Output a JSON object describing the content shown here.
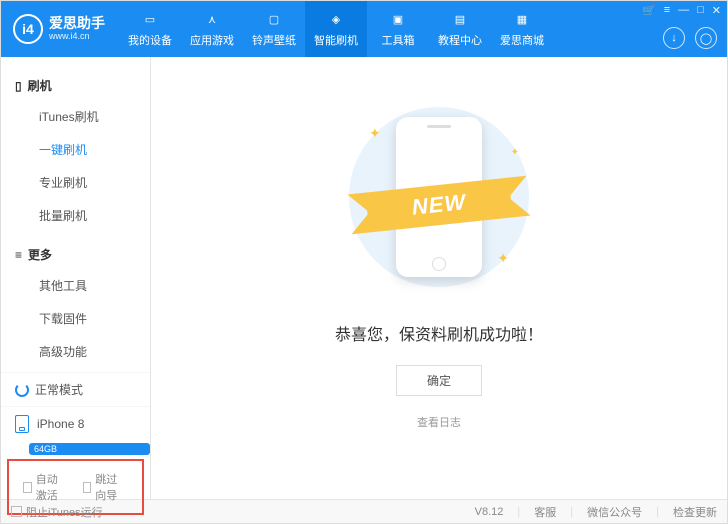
{
  "logo": {
    "badge": "i4",
    "title": "爱思助手",
    "subtitle": "www.i4.cn"
  },
  "nav": [
    {
      "label": "我的设备",
      "icon": "phone"
    },
    {
      "label": "应用游戏",
      "icon": "apps"
    },
    {
      "label": "铃声壁纸",
      "icon": "music"
    },
    {
      "label": "智能刷机",
      "icon": "flash",
      "active": true
    },
    {
      "label": "工具箱",
      "icon": "toolbox"
    },
    {
      "label": "教程中心",
      "icon": "book"
    },
    {
      "label": "爱思商城",
      "icon": "shop"
    }
  ],
  "sidebar": {
    "flash": {
      "title": "刷机",
      "items": [
        "iTunes刷机",
        "一键刷机",
        "专业刷机",
        "批量刷机"
      ],
      "activeIndex": 1
    },
    "more": {
      "title": "更多",
      "items": [
        "其他工具",
        "下载固件",
        "高级功能"
      ]
    },
    "status": "正常模式",
    "device": {
      "name": "iPhone 8",
      "storage": "64GB"
    },
    "checks": {
      "autoActivate": "自动激活",
      "skipGuide": "跳过向导"
    }
  },
  "main": {
    "ribbon": "NEW",
    "successText": "恭喜您，保资料刷机成功啦！",
    "okButton": "确定",
    "viewLog": "查看日志"
  },
  "footer": {
    "blockItunes": "阻止iTunes运行",
    "version": "V8.12",
    "support": "客服",
    "wechat": "微信公众号",
    "update": "检查更新"
  }
}
